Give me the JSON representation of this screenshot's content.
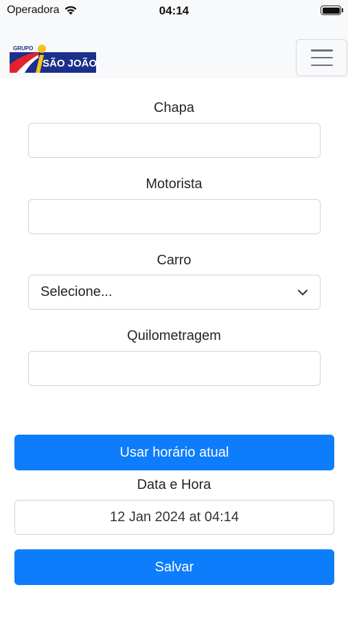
{
  "status_bar": {
    "carrier": "Operadora",
    "time": "04:14",
    "icons": [
      "wifi-icon",
      "battery-icon"
    ]
  },
  "navbar": {
    "logo_top_text": "GRUPO",
    "logo_text": "SÃO JOÃO",
    "menu_icon": "hamburger-icon",
    "colors": {
      "logo_blue": "#1c2f8a",
      "logo_red": "#e4222c",
      "logo_yellow": "#f7c21c"
    }
  },
  "form": {
    "chapa_label": "Chapa",
    "chapa_value": "",
    "motorista_label": "Motorista",
    "motorista_value": "",
    "carro_label": "Carro",
    "carro_selected": "Selecione...",
    "quilometragem_label": "Quilometragem",
    "quilometragem_value": "",
    "use_current_time_button": "Usar horário atual",
    "datetime_label": "Data e Hora",
    "datetime_value": "12 Jan 2024 at 04:14",
    "save_button": "Salvar"
  },
  "colors": {
    "primary": "#0d7dfc",
    "border": "#ced4da",
    "navbar_bg": "#f8f9fa"
  }
}
